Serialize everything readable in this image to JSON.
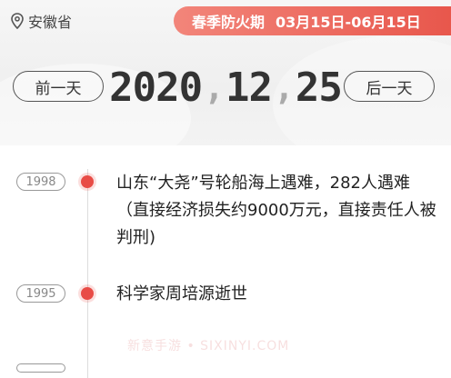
{
  "header": {
    "location": "安徽省",
    "location_icon": "location-pin-icon",
    "season_name": "春季防火期",
    "season_range": "03月15日-06月15日",
    "accent_color": "#e8574c"
  },
  "datebar": {
    "prev_label": "前一天",
    "next_label": "后一天",
    "year": "2020",
    "month": "12",
    "day": "25",
    "separator": ","
  },
  "events": [
    {
      "year": "1998",
      "text": "山东“大尧”号轮船海上遇难，282人遇难（直接经济损失约9000万元，直接责任人被判刑)"
    },
    {
      "year": "1995",
      "text": "科学家周培源逝世"
    }
  ],
  "watermark": "新意手游 • SIXINYI.COM"
}
